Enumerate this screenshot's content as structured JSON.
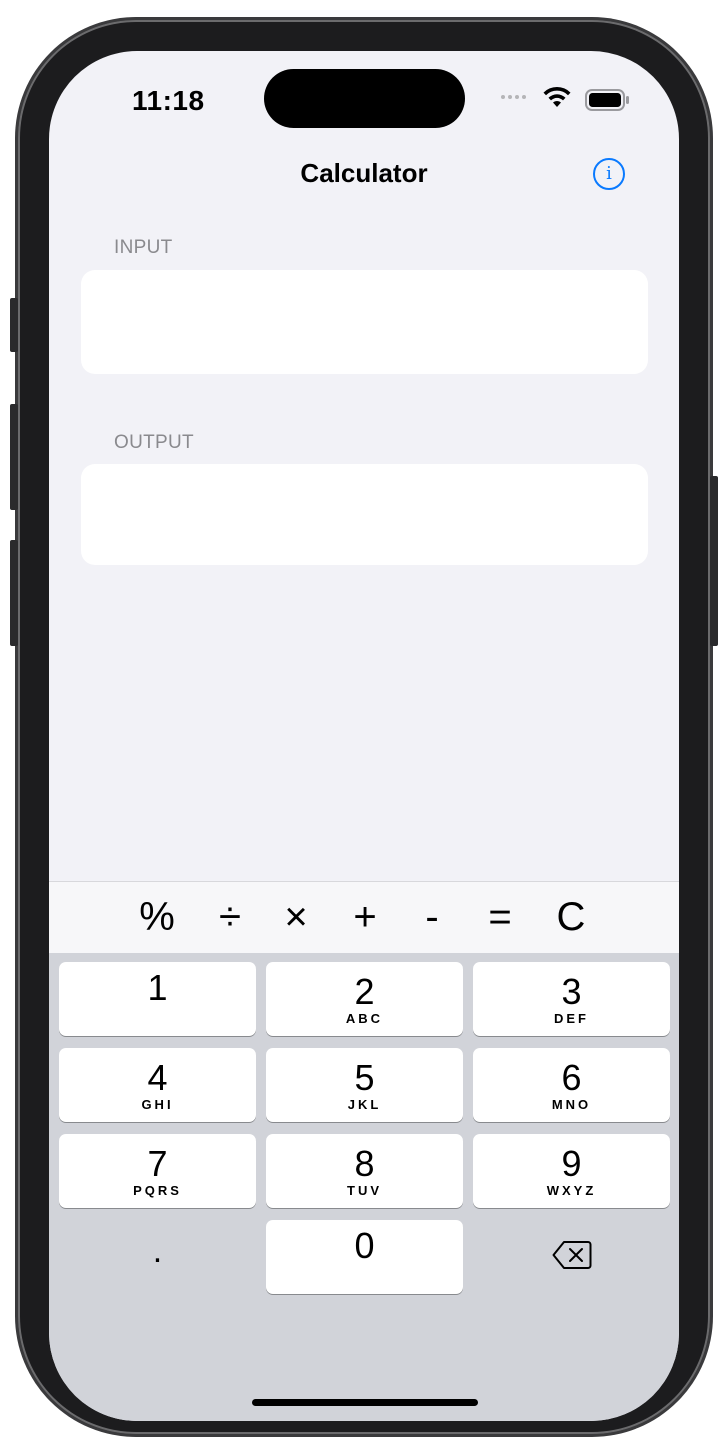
{
  "status_bar": {
    "time": "11:18"
  },
  "nav": {
    "title": "Calculator"
  },
  "input_section": {
    "label": "INPUT",
    "value": ""
  },
  "output_section": {
    "label": "OUTPUT",
    "value": ""
  },
  "operators": [
    "%",
    "÷",
    "×",
    "+",
    "-",
    "=",
    "C"
  ],
  "keypad": {
    "keys": [
      {
        "digit": "1",
        "letters": ""
      },
      {
        "digit": "2",
        "letters": "ABC"
      },
      {
        "digit": "3",
        "letters": "DEF"
      },
      {
        "digit": "4",
        "letters": "GHI"
      },
      {
        "digit": "5",
        "letters": "JKL"
      },
      {
        "digit": "6",
        "letters": "MNO"
      },
      {
        "digit": "7",
        "letters": "PQRS"
      },
      {
        "digit": "8",
        "letters": "TUV"
      },
      {
        "digit": "9",
        "letters": "WXYZ"
      }
    ],
    "decimal": ".",
    "zero": "0",
    "delete_icon": "delete-backward-icon"
  },
  "colors": {
    "accent": "#0a7aff",
    "screen_background": "#f2f2f7",
    "keypad_background": "#d1d3d9",
    "section_label": "#8a8a8e"
  }
}
